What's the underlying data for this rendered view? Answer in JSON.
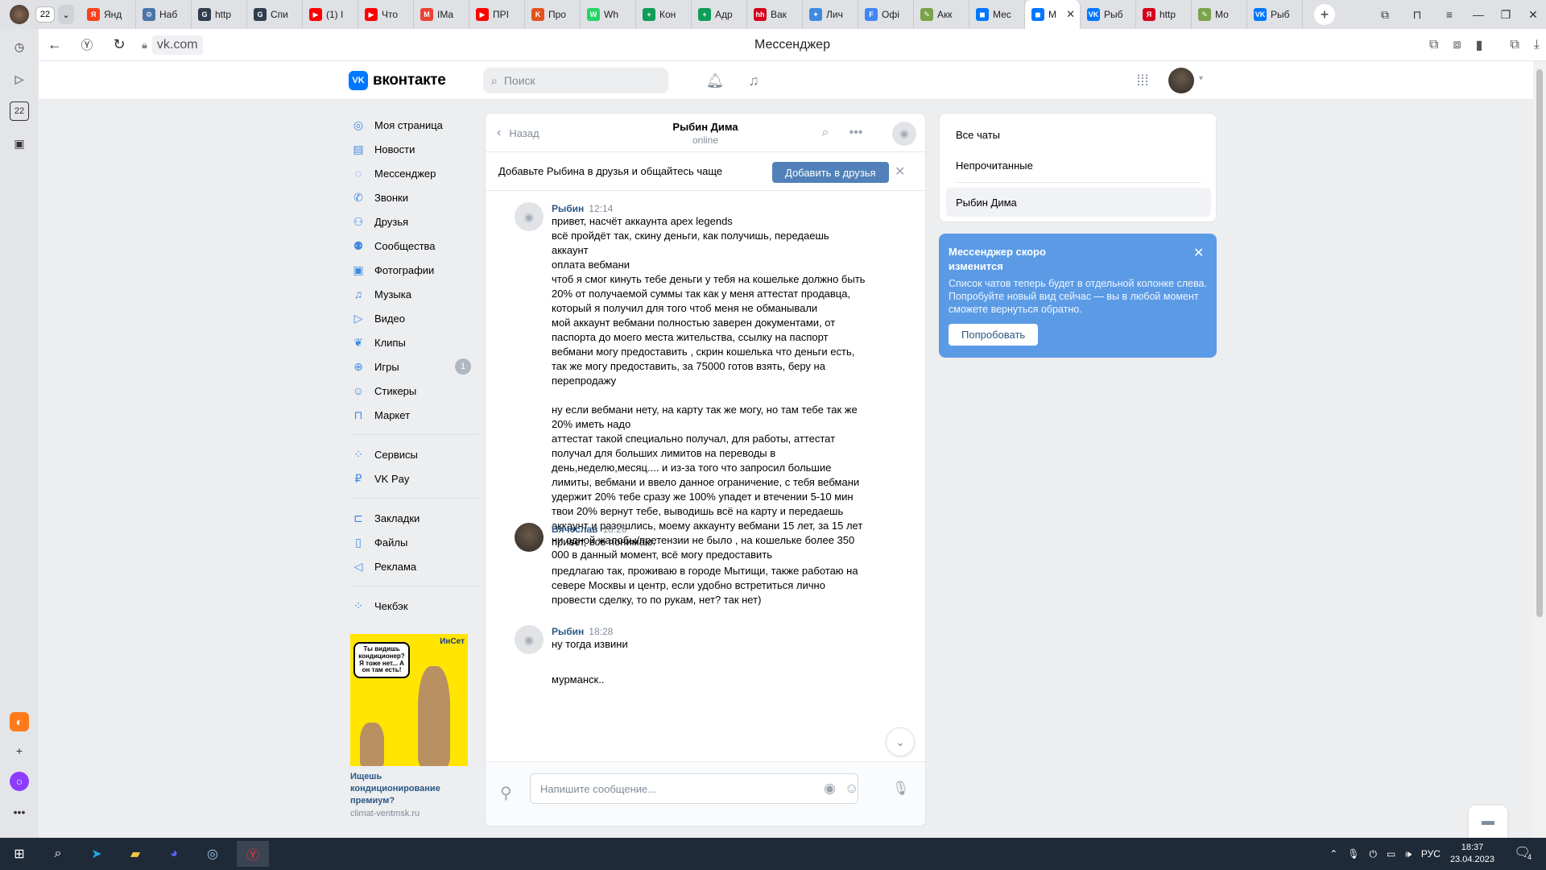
{
  "browser": {
    "tab_count": "22",
    "tabs": [
      {
        "label": "Янд",
        "color": "#fc3f1d",
        "glyph": "Я"
      },
      {
        "label": "Наб",
        "color": "#4a76a8",
        "glyph": "⚙"
      },
      {
        "label": "http",
        "color": "#2f3d4e",
        "glyph": "G"
      },
      {
        "label": "Спи",
        "color": "#2f3d4e",
        "glyph": "G"
      },
      {
        "label": "(1) I",
        "color": "#ff0000",
        "glyph": "▶"
      },
      {
        "label": "Что",
        "color": "#ff0000",
        "glyph": "▶"
      },
      {
        "label": "IMa",
        "color": "#ea4335",
        "glyph": "M"
      },
      {
        "label": "ПРІ",
        "color": "#ff0000",
        "glyph": "▶"
      },
      {
        "label": "Про",
        "color": "#e2521d",
        "glyph": "K"
      },
      {
        "label": "Wh",
        "color": "#25d366",
        "glyph": "W"
      },
      {
        "label": "Кон",
        "color": "#0f9d58",
        "glyph": "+"
      },
      {
        "label": "Адр",
        "color": "#0f9d58",
        "glyph": "+"
      },
      {
        "label": "Вак",
        "color": "#d6001c",
        "glyph": "hh"
      },
      {
        "label": "Лич",
        "color": "#3f8ae0",
        "glyph": "✦"
      },
      {
        "label": "Офі",
        "color": "#4285f4",
        "glyph": "F"
      },
      {
        "label": "Акк",
        "color": "#7aa34a",
        "glyph": "✎"
      },
      {
        "label": "Мес",
        "color": "#0077ff",
        "glyph": "◼"
      },
      {
        "label": "М",
        "color": "#0077ff",
        "glyph": "◼"
      },
      {
        "label": "Рыб",
        "color": "#0077ff",
        "glyph": "VK"
      },
      {
        "label": "http",
        "color": "#d6001c",
        "glyph": "Я"
      },
      {
        "label": "Мо",
        "color": "#7aa34a",
        "glyph": "✎"
      },
      {
        "label": "Рыб",
        "color": "#0077ff",
        "glyph": "VK"
      }
    ],
    "url": "vk.com",
    "page_title": "Мессенджер"
  },
  "vk": {
    "logo_text": "вконтакте",
    "search_placeholder": "Поиск"
  },
  "nav": [
    {
      "label": "Моя страница",
      "icon": "user-circle-icon",
      "glyph": "◎"
    },
    {
      "label": "Новости",
      "icon": "newsfeed-icon",
      "glyph": "▤"
    },
    {
      "label": "Мессенджер",
      "icon": "message-icon",
      "glyph": "◌"
    },
    {
      "label": "Звонки",
      "icon": "phone-icon",
      "glyph": "✆"
    },
    {
      "label": "Друзья",
      "icon": "friends-icon",
      "glyph": "⚇"
    },
    {
      "label": "Сообщества",
      "icon": "communities-icon",
      "glyph": "⚉"
    },
    {
      "label": "Фотографии",
      "icon": "photo-icon",
      "glyph": "▣"
    },
    {
      "label": "Музыка",
      "icon": "music-icon",
      "glyph": "♫"
    },
    {
      "label": "Видео",
      "icon": "video-icon",
      "glyph": "▷"
    },
    {
      "label": "Клипы",
      "icon": "clips-icon",
      "glyph": "❦"
    },
    {
      "label": "Игры",
      "icon": "games-icon",
      "glyph": "⊕",
      "badge": "1"
    },
    {
      "label": "Стикеры",
      "icon": "stickers-icon",
      "glyph": "☺"
    },
    {
      "label": "Маркет",
      "icon": "market-icon",
      "glyph": "⊓"
    }
  ],
  "nav2": [
    {
      "label": "Сервисы",
      "icon": "services-icon",
      "glyph": "⁘"
    },
    {
      "label": "VK Pay",
      "icon": "vkpay-icon",
      "glyph": "₽"
    }
  ],
  "nav3": [
    {
      "label": "Закладки",
      "icon": "bookmark-icon",
      "glyph": "⊏"
    },
    {
      "label": "Файлы",
      "icon": "file-icon",
      "glyph": "▯"
    },
    {
      "label": "Реклама",
      "icon": "ads-icon",
      "glyph": "◁"
    }
  ],
  "nav4": [
    {
      "label": "Чекбэк",
      "icon": "checkback-icon",
      "glyph": "⁘"
    }
  ],
  "promo": {
    "bubble": "Ты видишь кондиционер? Я тоже нет... А он там есть!",
    "brand": "ИнСет",
    "title": "Ищешь кондиционирование премиум?",
    "site": "climat-ventmsk.ru"
  },
  "chat": {
    "back_label": "Назад",
    "peer_name": "Рыбин Дима",
    "peer_status": "online",
    "friend_prompt": "Добавьте Рыбина в друзья и общайтесь чаще",
    "add_friend_label": "Добавить в друзья",
    "input_placeholder": "Напишите сообщение...",
    "messages": [
      {
        "author": "Рыбин",
        "time": "12:14",
        "text": "привет, насчёт аккаунта apex legends\nвсё пройдёт так, скину деньги, как получишь, передаешь аккаунт\nоплата вебмани\nчтоб я смог кинуть тебе деньги у тебя на кошельке должно быть 20% от получаемой суммы так как у меня аттестат продавца, который я получил для того чтоб меня не обманывали\nмой аккаунт вебмани полностью заверен документами, от паспорта до моего места жительства, ссылку на паспорт вебмани могу предоставить , скрин кошелька что деньги есть, так же могу предоставить, за 75000 готов взять, беру на перепродажу\n\nну если вебмани нету, на карту так же могу, но там тебе так же 20% иметь надо\nаттестат такой специально получал, для работы, аттестат получал для больших лимитов на переводы в день,неделю,месяц.... и из-за того что запросил большие лимиты, вебмани и ввело данное ограничение, с тебя вебмани удержит 20% тебе сразу же 100% упадет и втечении 5-10 мин твои 20% вернут тебе, выводишь всё на карту и передаешь аккаунт и разошлись, моему аккаунту вебмани 15 лет, за 15 лет ни одной жалобы/претензии не было , на кошельке более 350 000 в данный момент, всё могу предоставить"
      },
      {
        "author": "Вячеслав",
        "time": "18:28",
        "text": "привет, все понимаю.\n\nпредлагаю так, проживаю в городе Мытищи, также работаю на севере Москвы и центр, если удобно встретиться лично провести сделку, то по рукам, нет? так нет)"
      },
      {
        "author": "Рыбин",
        "time": "18:28",
        "text": "ну тогда извини\n\nмурманск.."
      }
    ]
  },
  "chatlist": {
    "all": "Все чаты",
    "unread": "Непрочитанные",
    "current": "Рыбин Дима"
  },
  "notice": {
    "title": "Мессенджер скоро изменится",
    "text": "Список чатов теперь будет в отдельной колонке слева. Попробуйте новый вид сейчас — вы в любой момент сможете вернуться обратно.",
    "button": "Попробовать"
  },
  "taskbar": {
    "lang": "РУС",
    "time": "18:37",
    "date": "23.04.2023",
    "notif_count": "4"
  }
}
